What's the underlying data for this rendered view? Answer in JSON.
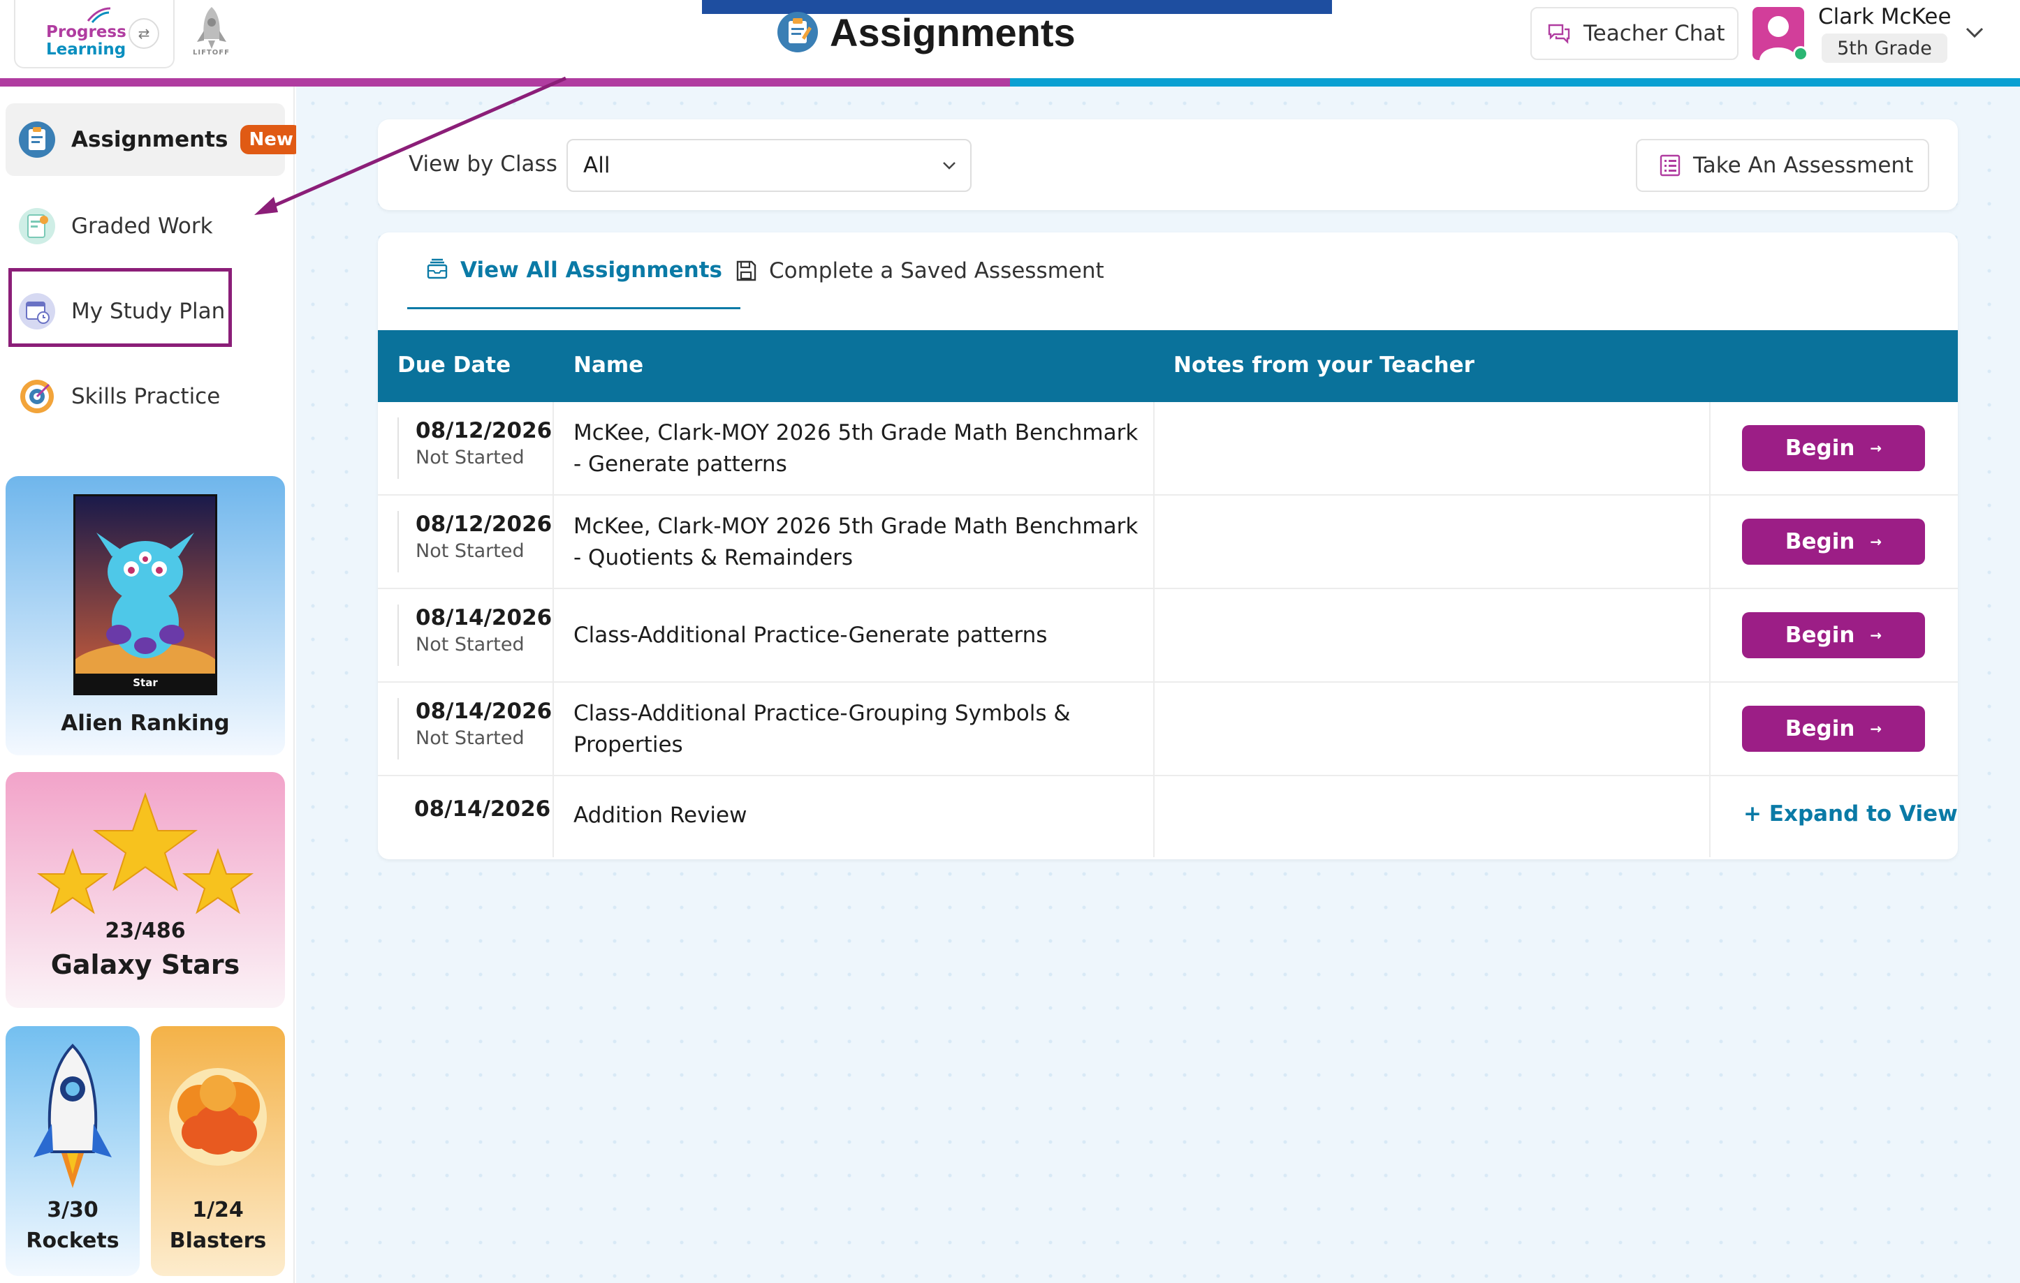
{
  "header": {
    "logo_line1": "Progress",
    "logo_line2": "Learning",
    "liftoff_label": "LIFTOFF",
    "page_title": "Assignments",
    "teacher_chat_label": "Teacher Chat",
    "user_name": "Clark McKee",
    "user_grade": "5th Grade"
  },
  "progress": {
    "fill_fraction": 0.5
  },
  "sidebar": {
    "items": [
      {
        "label": "Assignments",
        "badge": "New",
        "icon": "clipboard-icon",
        "active": true
      },
      {
        "label": "Graded Work",
        "icon": "graded-paper-icon",
        "active": false
      },
      {
        "label": "My Study Plan",
        "icon": "calendar-clock-icon",
        "active": false
      },
      {
        "label": "Skills Practice",
        "icon": "target-icon",
        "active": false
      }
    ],
    "alien_card": {
      "label": "Alien Ranking",
      "poster_title": "Star"
    },
    "stars_card": {
      "count": "23/486",
      "label": "Galaxy Stars"
    },
    "rockets_card": {
      "count": "3/30",
      "label": "Rockets"
    },
    "blasters_card": {
      "count": "1/24",
      "label": "Blasters"
    }
  },
  "filter": {
    "label": "View by Class",
    "selected": "All",
    "take_assessment_label": "Take An Assessment"
  },
  "tabs": {
    "all": "View All Assignments",
    "saved": "Complete a Saved Assessment"
  },
  "table": {
    "headers": {
      "due_date": "Due Date",
      "name": "Name",
      "notes": "Notes from your Teacher"
    },
    "rows": [
      {
        "date": "08/12/2026",
        "status": "Not Started",
        "name": "McKee, Clark-MOY 2026 5th Grade Math Benchmark - Generate patterns",
        "action": "Begin"
      },
      {
        "date": "08/12/2026",
        "status": "Not Started",
        "name": "McKee, Clark-MOY 2026 5th Grade Math Benchmark - Quotients & Remainders",
        "action": "Begin"
      },
      {
        "date": "08/14/2026",
        "status": "Not Started",
        "name": "Class-Additional Practice-Generate patterns",
        "action": "Begin"
      },
      {
        "date": "08/14/2026",
        "status": "Not Started",
        "name": "Class-Additional Practice-Grouping Symbols & Properties",
        "action": "Begin"
      },
      {
        "date": "08/14/2026",
        "status": "",
        "name": "Addition Review",
        "action": "+ Expand to View"
      }
    ]
  },
  "colors": {
    "brand_purple": "#9c1e86",
    "brand_blue": "#0a729b",
    "badge_orange": "#e05a14",
    "annotation_purple": "#8b1e78"
  }
}
